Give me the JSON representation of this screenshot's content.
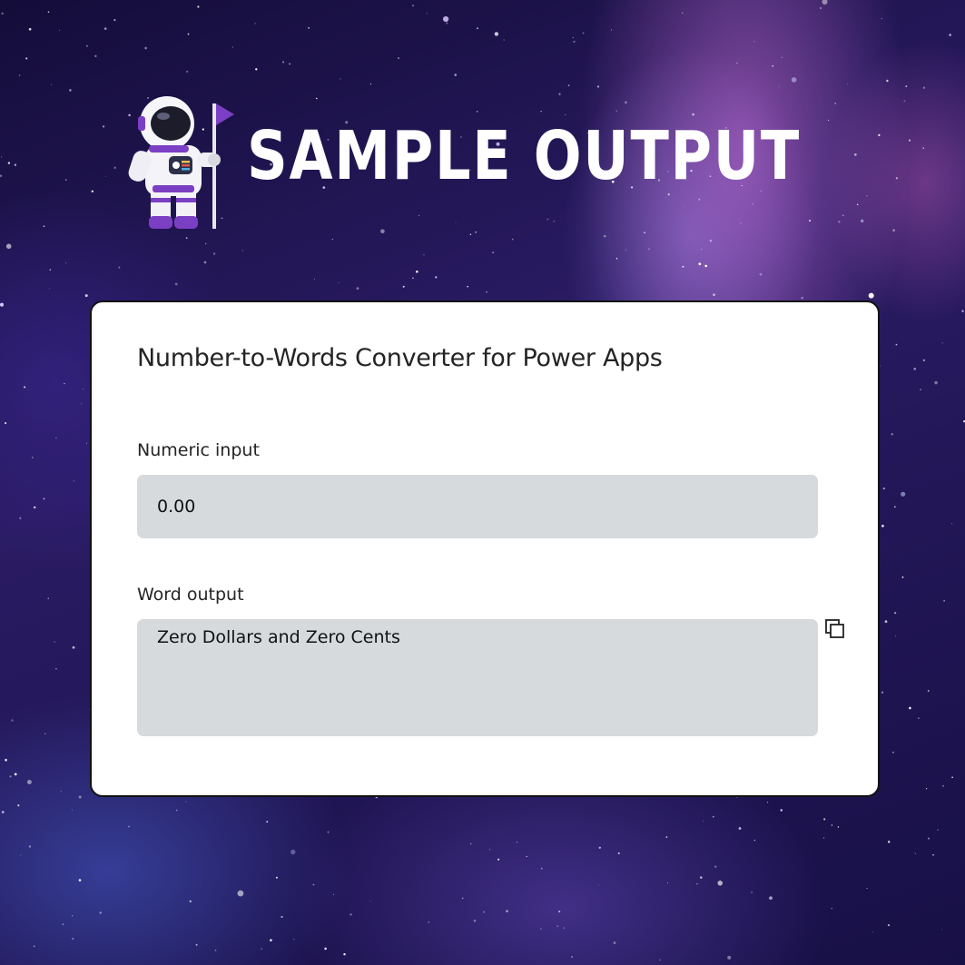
{
  "header": {
    "title": "SAMPLE OUTPUT",
    "mascot_icon": "astronaut-with-flag-icon"
  },
  "card": {
    "title": "Number-to-Words Converter for Power Apps",
    "numeric_input": {
      "label": "Numeric input",
      "value": "0.00"
    },
    "word_output": {
      "label": "Word output",
      "value": "Zero Dollars and Zero Cents",
      "copy_icon": "copy-icon"
    }
  },
  "colors": {
    "background": "#1a1444",
    "card_background": "#ffffff",
    "card_border": "#111111",
    "field_background": "#d6dadd",
    "headline_text": "#ffffff",
    "body_text": "#242424",
    "flag_accent": "#7b3fc4"
  }
}
